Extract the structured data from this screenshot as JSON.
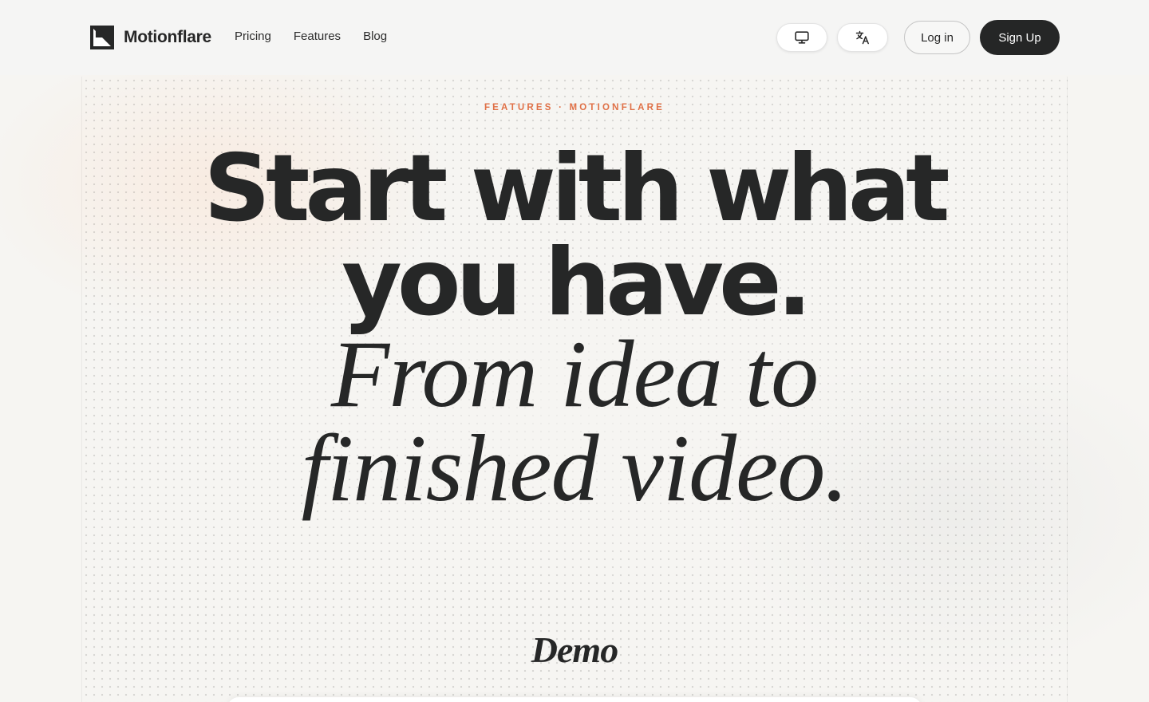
{
  "header": {
    "brand": "Motionflare",
    "nav": [
      {
        "label": "Pricing"
      },
      {
        "label": "Features"
      },
      {
        "label": "Blog"
      }
    ],
    "display_icon": "monitor-icon",
    "language_icon": "translate-icon",
    "login_label": "Log in",
    "signup_label": "Sign Up"
  },
  "hero": {
    "eyebrow": "FEATURES · MOTIONFLARE",
    "headline_line1": "Start with what",
    "headline_line2": "you have.",
    "subhead_line1": "From idea to",
    "subhead_line2": "finished video."
  },
  "demo": {
    "title": "Demo"
  },
  "colors": {
    "accent": "#e07046",
    "text": "#262727",
    "background": "#f6f5f2",
    "button_dark": "#252626"
  }
}
